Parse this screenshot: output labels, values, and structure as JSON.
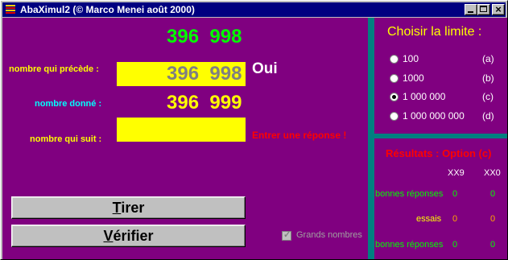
{
  "window": {
    "title": "AbaXimul2 (© Marco Menei août 2000)",
    "controls": {
      "minimize": "_",
      "maximize": "□",
      "close": "×"
    }
  },
  "main": {
    "top_number": "396  998",
    "preceding_label": "nombre qui précède :",
    "preceding_value": "396  998",
    "preceding_feedback": "Oui",
    "given_label": "nombre donné :",
    "given_value": "396  999",
    "next_label": "nombre qui suit :",
    "next_value": "",
    "next_feedback": "Entrer une réponse !",
    "draw_button": {
      "underlined": "T",
      "rest": "irer"
    },
    "check_button": {
      "underlined": "V",
      "rest": "érifier"
    },
    "big_numbers_checkbox": {
      "label": "Grands nombres",
      "checked": true,
      "enabled": false
    }
  },
  "limit_panel": {
    "title": "Choisir la limite :",
    "options": [
      {
        "label": "100",
        "key": "(a)",
        "selected": false
      },
      {
        "label": "1000",
        "key": "(b)",
        "selected": false
      },
      {
        "label": "1 000 000",
        "key": "(c)",
        "selected": true
      },
      {
        "label": "1 000 000 000",
        "key": "(d)",
        "selected": false
      }
    ]
  },
  "results_panel": {
    "title": "Résultats : Option (c)",
    "columns": [
      "XX9",
      "XX0"
    ],
    "rows": [
      {
        "label": "bonnes réponses",
        "values": [
          "0",
          "0"
        ]
      },
      {
        "label": "essais",
        "values": [
          "0",
          "0"
        ]
      },
      {
        "label": "bonnes réponses",
        "values": [
          "0",
          "0"
        ]
      }
    ]
  },
  "colors": {
    "background": "#800080",
    "divider": "#008080",
    "green_number": "#00ff00",
    "yellow": "#ffff00",
    "gray_number": "#808080",
    "cyan_label": "#00ffff",
    "red": "#ff0000",
    "orange_value": "#ffa500"
  }
}
